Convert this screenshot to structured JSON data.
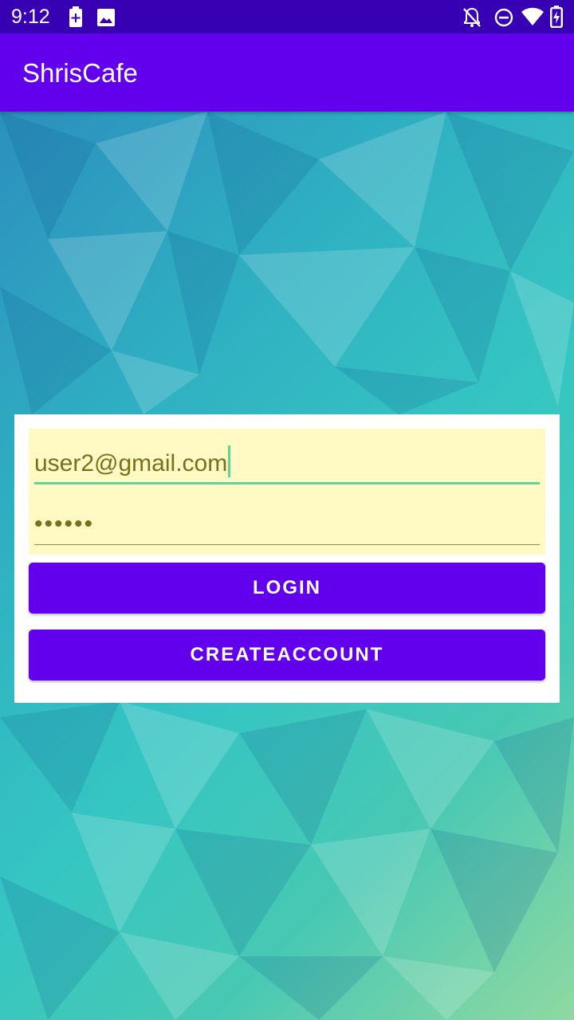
{
  "status_bar": {
    "time": "9:12",
    "icons": [
      "battery-saver-plus-icon",
      "image-icon",
      "notifications-off-icon",
      "do-not-disturb-icon",
      "wifi-icon",
      "battery-charging-icon"
    ],
    "background": "#3700b3"
  },
  "app_bar": {
    "title": "ShrisCafe",
    "background": "#6200ee"
  },
  "login_form": {
    "email_value": "user2@gmail.com",
    "password_masked": "••••••",
    "field_background": "#fff9c4",
    "login_label": "LOGIN",
    "create_account_label": "CREATEACCOUNT",
    "button_color": "#6200ee"
  }
}
